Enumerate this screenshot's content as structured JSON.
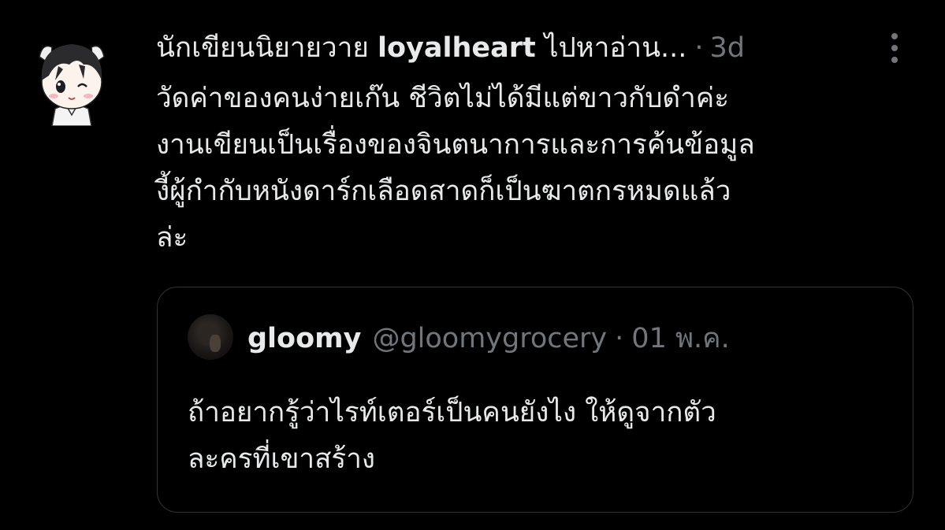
{
  "tweet": {
    "author_name_prefix": "นักเขียนนิยายวาย ",
    "author_name_bold": "loyalheart",
    "author_name_suffix": " ไปหาอ่าน...",
    "separator": "·",
    "time": "3d",
    "more_icon": "more-vertical-icon",
    "text_lines": [
      "วัดค่าของคนง่ายเก๊น ชีวิตไม่ได้มีแต่ขาวกับดำค่ะ",
      "งานเขียนเป็นเรื่องของจินตนาการและการค้นข้อมูล",
      "งี้ผู้กำกับหนังดาร์กเลือดสาดก็เป็นฆาตกรหมดแล้ว",
      "ล่ะ"
    ]
  },
  "quote": {
    "name": "gloomy",
    "handle": "@gloomygrocery",
    "separator": "·",
    "time": "01 พ.ค.",
    "text_lines": [
      "ถ้าอยากรู้ว่าไรท์เตอร์เป็นคนยังไง ให้ดูจากตัว",
      "ละครที่เขาสร้าง"
    ]
  },
  "colors": {
    "background": "#000000",
    "primary_text": "#e7e9ea",
    "secondary_text": "#71767b",
    "border": "#2f3336"
  }
}
